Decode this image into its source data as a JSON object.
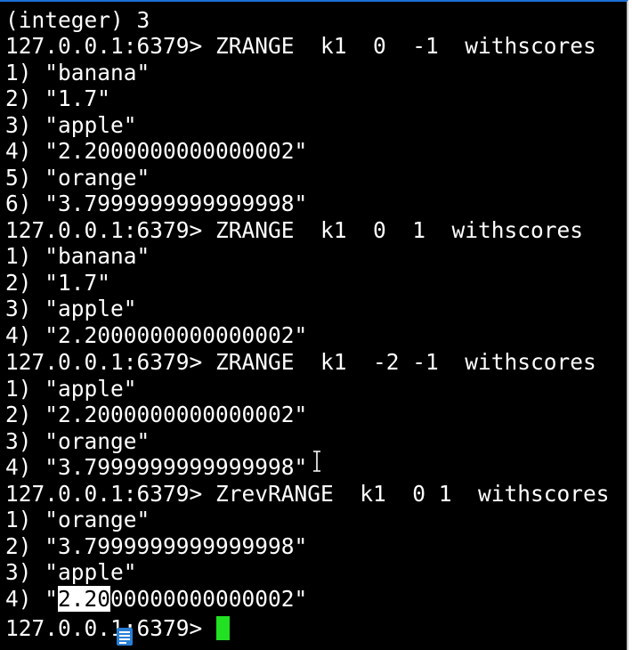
{
  "terminal": {
    "lines": [
      "(integer) 3",
      "127.0.0.1:6379> ZRANGE  k1  0  -1  withscores",
      "1) \"banana\"",
      "2) \"1.7\"",
      "3) \"apple\"",
      "4) \"2.2000000000000002\"",
      "5) \"orange\"",
      "6) \"3.7999999999999998\"",
      "127.0.0.1:6379> ZRANGE  k1  0  1  withscores",
      "1) \"banana\"",
      "2) \"1.7\"",
      "3) \"apple\"",
      "4) \"2.2000000000000002\"",
      "127.0.0.1:6379> ZRANGE  k1  -2 -1  withscores",
      "1) \"apple\"",
      "2) \"2.2000000000000002\"",
      "3) \"orange\"",
      "4) \"3.7999999999999998\"",
      "127.0.0.1:6379> ZrevRANGE  k1  0 1  withscores",
      "1) \"orange\"",
      "2) \"3.7999999999999998\"",
      "3) \"apple\""
    ],
    "selected_line": {
      "before": "4) \"",
      "selected": "2.20",
      "after": "00000000000002\""
    },
    "prompt": "127.0.0.1:6379> "
  },
  "colors": {
    "background": "#000000",
    "text": "#ffffff",
    "cursor": "#22e022",
    "window_border": "#1a6fd6"
  },
  "icons": [
    "text-cursor-icon",
    "document-icon"
  ]
}
